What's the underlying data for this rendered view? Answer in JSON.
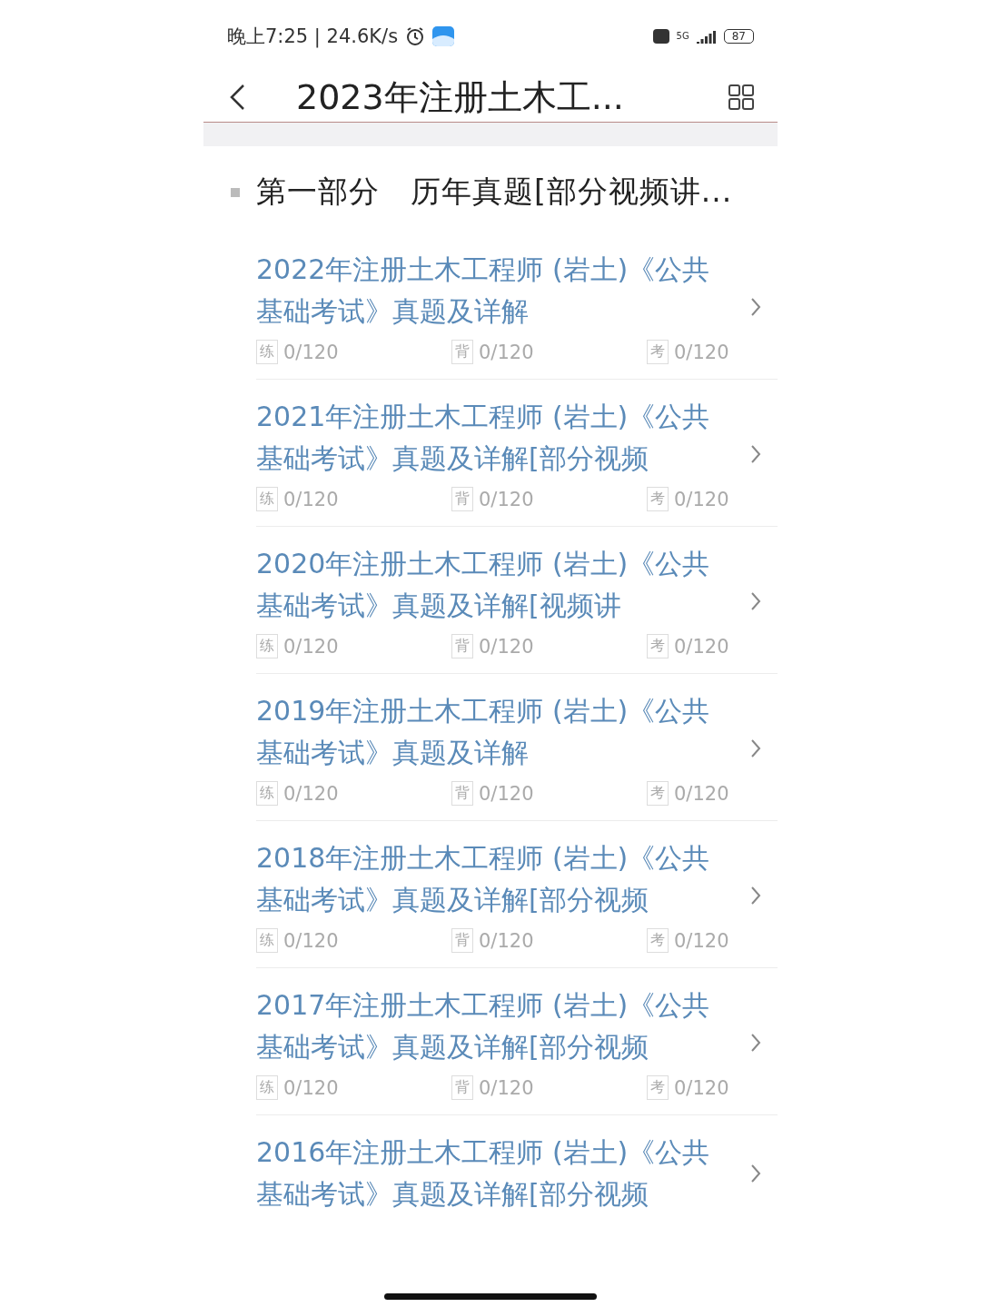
{
  "status_bar": {
    "time": "晚上7:25 | 24.6K/s",
    "network": "5G",
    "battery": "87"
  },
  "header": {
    "title": "2023年注册土木工..."
  },
  "section": {
    "title": "第一部分　历年真题[部分视频讲..."
  },
  "items": [
    {
      "title": "2022年注册土木工程师 (岩土)《公共基础考试》真题及详解",
      "stats": [
        {
          "tag": "练",
          "value": "0/120"
        },
        {
          "tag": "背",
          "value": "0/120"
        },
        {
          "tag": "考",
          "value": "0/120"
        }
      ]
    },
    {
      "title": "2021年注册土木工程师 (岩土)《公共基础考试》真题及详解[部分视频",
      "stats": [
        {
          "tag": "练",
          "value": "0/120"
        },
        {
          "tag": "背",
          "value": "0/120"
        },
        {
          "tag": "考",
          "value": "0/120"
        }
      ]
    },
    {
      "title": "2020年注册土木工程师 (岩土)《公共基础考试》真题及详解[视频讲",
      "stats": [
        {
          "tag": "练",
          "value": "0/120"
        },
        {
          "tag": "背",
          "value": "0/120"
        },
        {
          "tag": "考",
          "value": "0/120"
        }
      ]
    },
    {
      "title": "2019年注册土木工程师 (岩土)《公共基础考试》真题及详解",
      "stats": [
        {
          "tag": "练",
          "value": "0/120"
        },
        {
          "tag": "背",
          "value": "0/120"
        },
        {
          "tag": "考",
          "value": "0/120"
        }
      ]
    },
    {
      "title": "2018年注册土木工程师 (岩土)《公共基础考试》真题及详解[部分视频",
      "stats": [
        {
          "tag": "练",
          "value": "0/120"
        },
        {
          "tag": "背",
          "value": "0/120"
        },
        {
          "tag": "考",
          "value": "0/120"
        }
      ]
    },
    {
      "title": "2017年注册土木工程师 (岩土)《公共基础考试》真题及详解[部分视频",
      "stats": [
        {
          "tag": "练",
          "value": "0/120"
        },
        {
          "tag": "背",
          "value": "0/120"
        },
        {
          "tag": "考",
          "value": "0/120"
        }
      ]
    },
    {
      "title": "2016年注册土木工程师 (岩土)《公共基础考试》真题及详解[部分视频"
    }
  ]
}
